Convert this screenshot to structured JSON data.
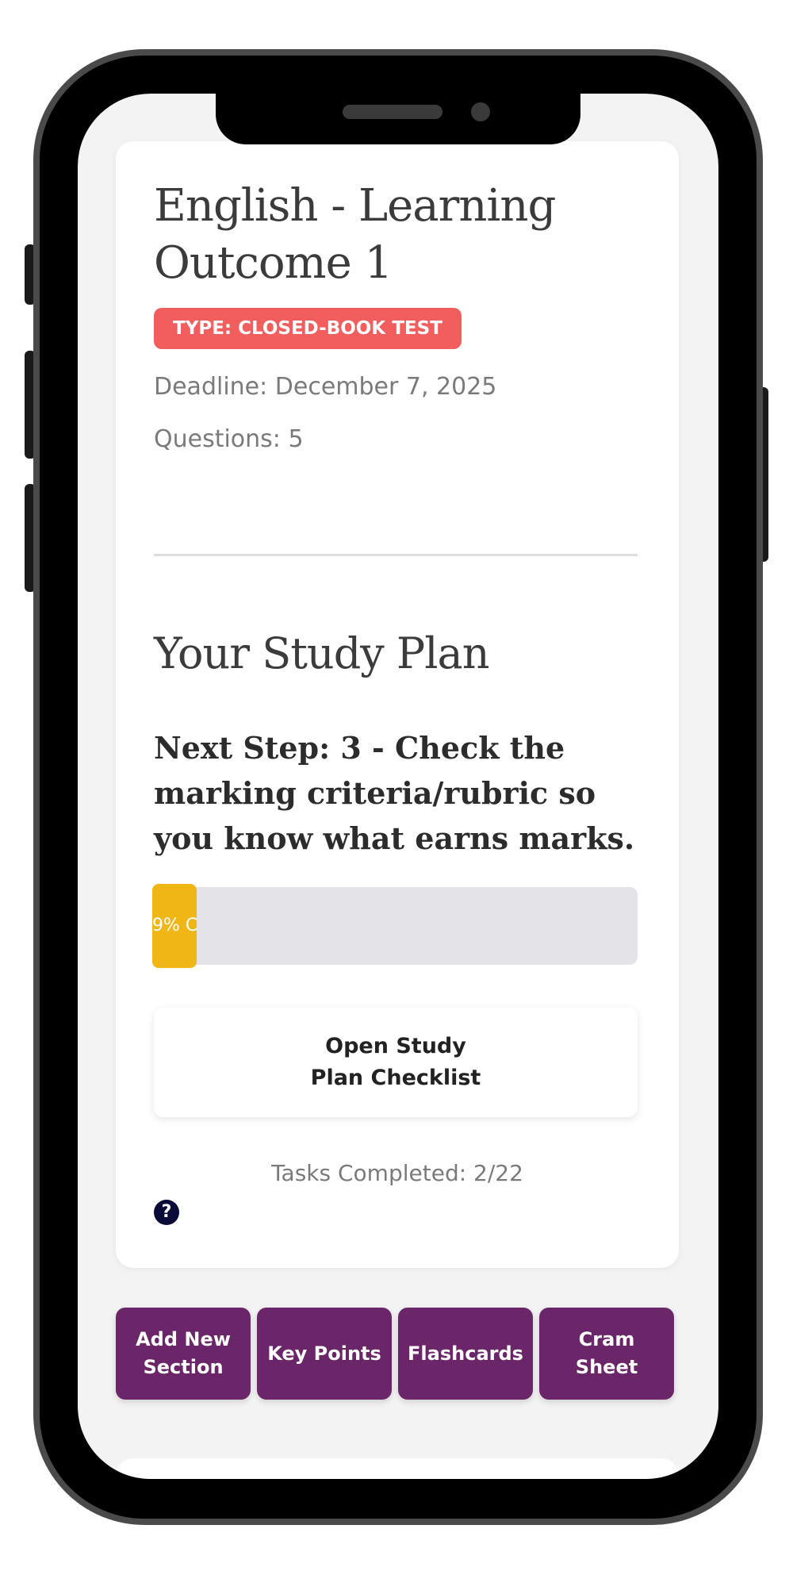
{
  "assessment": {
    "title": "English - Learning Outcome 1",
    "type_badge": "TYPE: CLOSED-BOOK TEST",
    "deadline": "Deadline: December 7, 2025",
    "questions": "Questions: 5"
  },
  "study_plan": {
    "heading": "Your Study Plan",
    "next_step": "Next Step: 3 - Check the marking criteria/rubric so you know what earns marks.",
    "progress": {
      "percent": 9,
      "label": "9% C",
      "fill_color": "#f0b616"
    },
    "open_checklist_label": "Open Study Plan Checklist",
    "tasks_completed": "Tasks Completed: 2/22",
    "help_glyph": "?"
  },
  "actions": {
    "add_section": "Add New Section",
    "key_points": "Key Points",
    "flashcards": "Flashcards",
    "cram_sheet": "Cram Sheet"
  },
  "colors": {
    "badge": "#f25e5e",
    "action_button": "#6a2668",
    "help_icon": "#0b0b3a"
  },
  "icons": {
    "help": "question-circle-icon"
  }
}
